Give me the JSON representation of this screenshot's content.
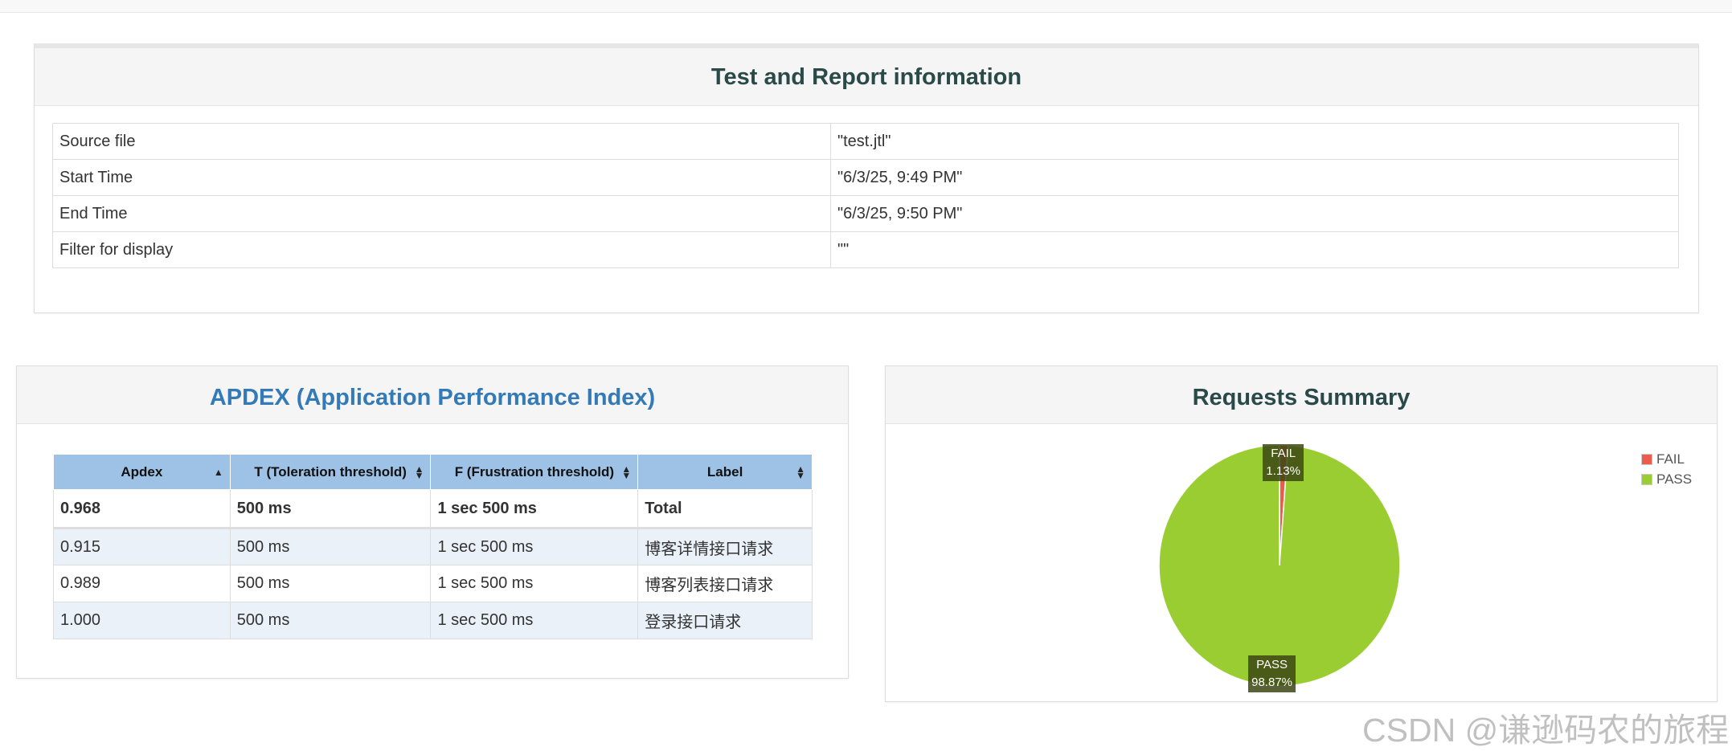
{
  "info_panel": {
    "title": "Test and Report information",
    "rows": [
      {
        "label": "Source file",
        "value": "\"test.jtl\""
      },
      {
        "label": "Start Time",
        "value": "\"6/3/25, 9:49 PM\""
      },
      {
        "label": "End Time",
        "value": "\"6/3/25, 9:50 PM\""
      },
      {
        "label": "Filter for display",
        "value": "\"\""
      }
    ]
  },
  "apdex_panel": {
    "title": "APDEX (Application Performance Index)",
    "title_color": "#337ab7",
    "columns": [
      "Apdex",
      "T (Toleration threshold)",
      "F (Frustration threshold)",
      "Label"
    ],
    "total": {
      "apdex": "0.968",
      "t": "500 ms",
      "f": "1 sec 500 ms",
      "label": "Total"
    },
    "rows": [
      {
        "apdex": "0.915",
        "t": "500 ms",
        "f": "1 sec 500 ms",
        "label": "博客详情接口请求"
      },
      {
        "apdex": "0.989",
        "t": "500 ms",
        "f": "1 sec 500 ms",
        "label": "博客列表接口请求"
      },
      {
        "apdex": "1.000",
        "t": "500 ms",
        "f": "1 sec 500 ms",
        "label": "登录接口请求"
      }
    ]
  },
  "requests_panel": {
    "title": "Requests Summary"
  },
  "chart_data": {
    "type": "pie",
    "slices": [
      {
        "name": "FAIL",
        "value": 1.13,
        "display": "1.13%",
        "color": "#ea5d4b"
      },
      {
        "name": "PASS",
        "value": 98.87,
        "display": "98.87%",
        "color": "#9acd32"
      }
    ],
    "legend": [
      "FAIL",
      "PASS"
    ],
    "legend_position": "top-right"
  },
  "watermark": "CSDN @谦逊码农的旅程"
}
